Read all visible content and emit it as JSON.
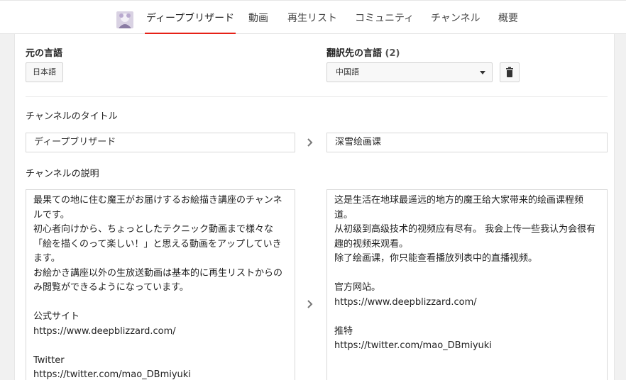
{
  "nav": {
    "tabs": [
      {
        "label": "ディープブリザード",
        "active": true
      },
      {
        "label": "動画"
      },
      {
        "label": "再生リスト"
      },
      {
        "label": "コミュニティ"
      },
      {
        "label": "チャンネル"
      },
      {
        "label": "概要"
      }
    ]
  },
  "source_language": {
    "heading": "元の言語",
    "value": "日本語"
  },
  "target_language": {
    "heading": "翻訳先の言語",
    "count": "(2)",
    "selected": "中国語"
  },
  "title_section": {
    "heading": "チャンネルのタイトル",
    "original": "ディープブリザード",
    "translated": "深雪绘画课"
  },
  "description_section": {
    "heading": "チャンネルの説明",
    "original_lines": [
      "最果ての地に住む魔王がお届けするお絵描き講座のチャンネ",
      "ルです。",
      "初心者向けから、ちょっとしたテクニック動画まで様々な",
      "「絵を描くのって楽しい！」と思える動画をアップしていき",
      "ます。",
      "お絵かき講座以外の生放送動画は基本的に再生リストからの",
      "み閲覧ができるようになっています。",
      "",
      "公式サイト",
      "https://www.deepblizzard.com/",
      "",
      "Twitter",
      "https://twitter.com/mao_DBmiyuki"
    ],
    "translated_lines": [
      "这是生活在地球最遥远的地方的魔王给大家带来的绘画课程频",
      "道。",
      "从初级到高级技术的视频应有尽有。 我会上传一些我认为会很有",
      "趣的视频来观看。",
      "除了绘画课，你只能查看播放列表中的直播视频。",
      "",
      "官方网站。",
      "https://www.deepblizzard.com/",
      "",
      "推特",
      "https://twitter.com/mao_DBmiyuki"
    ]
  },
  "colors": {
    "accent": "#e62117",
    "background": "#f1f1f1",
    "card": "#ffffff"
  }
}
